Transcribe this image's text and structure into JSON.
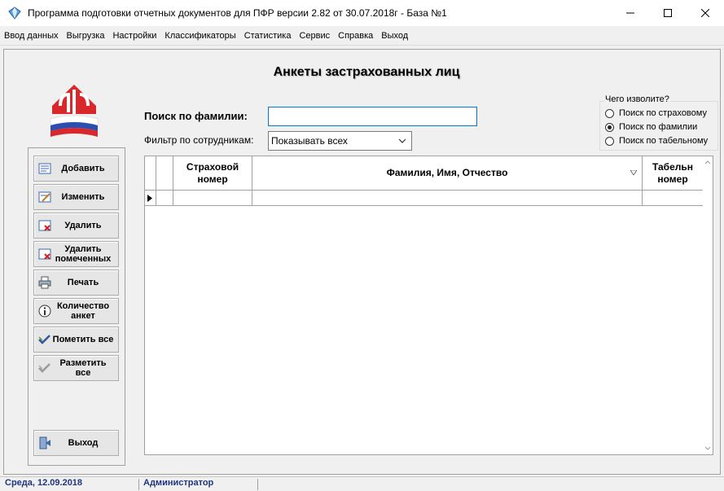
{
  "window": {
    "title": "Программа подготовки отчетных документов для ПФР версии 2.82 от 30.07.2018г - База №1",
    "controls": [
      "minimize-icon",
      "maximize-icon",
      "close-icon"
    ]
  },
  "menu": [
    "Ввод данных",
    "Выгрузка",
    "Настройки",
    "Классификаторы",
    "Статистика",
    "Сервис",
    "Справка",
    "Выход"
  ],
  "form": {
    "title": "Анкеты застрахованных лиц",
    "logo_icon": "pfr-logo-icon"
  },
  "toolbar": [
    {
      "label": "Добавить",
      "icon": "add-card-icon"
    },
    {
      "label": "Изменить",
      "icon": "edit-card-icon"
    },
    {
      "label": "Удалить",
      "icon": "delete-card-icon"
    },
    {
      "label": "Удалить помеченных",
      "icon": "delete-marked-icon"
    },
    {
      "label": "Печать",
      "icon": "printer-icon"
    },
    {
      "label": "Количество анкет",
      "icon": "info-icon"
    },
    {
      "label": "Пометить все",
      "icon": "check-all-icon"
    },
    {
      "label": "Разметить все",
      "icon": "uncheck-all-icon"
    },
    {
      "label": "Выход",
      "icon": "exit-door-icon"
    }
  ],
  "search": {
    "label": "Поиск по фамилии:",
    "value": ""
  },
  "filter": {
    "label": "Фильтр по сотрудникам:",
    "selected": "Показывать всех"
  },
  "search_mode": {
    "title": "Чего изволите?",
    "options": [
      {
        "label": "Поиск по страховому",
        "checked": false
      },
      {
        "label": "Поиск по фамилии",
        "checked": true
      },
      {
        "label": "Поиск по табельному",
        "checked": false
      }
    ]
  },
  "grid": {
    "columns": [
      "Страховой номер",
      "Фамилия, Имя, Отчество",
      "Табельн номер"
    ],
    "sort_indicator_icon": "sort-triangle-icon",
    "row_indicator_icon": "current-row-arrow-icon",
    "rows": []
  },
  "status": {
    "date": "Среда, 12.09.2018",
    "user": "Администратор"
  }
}
